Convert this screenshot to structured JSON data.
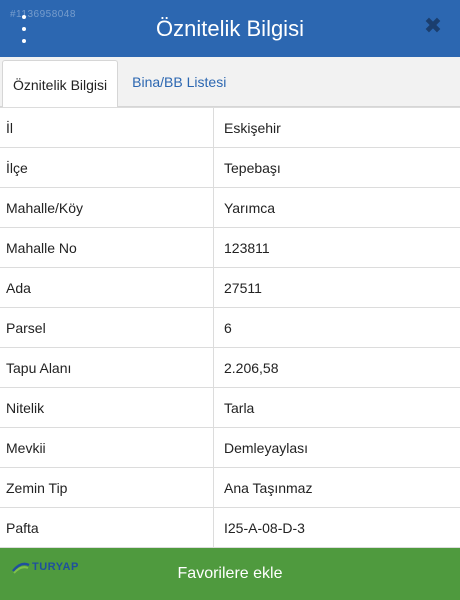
{
  "header": {
    "title": "Öznitelik Bilgisi",
    "listing_id": "#1136958048"
  },
  "tabs": [
    {
      "label": "Öznitelik Bilgisi",
      "active": true
    },
    {
      "label": "Bina/BB Listesi",
      "active": false
    }
  ],
  "attributes": [
    {
      "key": "İl",
      "value": "Eskişehir"
    },
    {
      "key": "İlçe",
      "value": "Tepebaşı"
    },
    {
      "key": "Mahalle/Köy",
      "value": "Yarımca"
    },
    {
      "key": "Mahalle No",
      "value": "123811"
    },
    {
      "key": "Ada",
      "value": "27511"
    },
    {
      "key": "Parsel",
      "value": "6"
    },
    {
      "key": "Tapu Alanı",
      "value": "2.206,58"
    },
    {
      "key": "Nitelik",
      "value": "Tarla"
    },
    {
      "key": "Mevkii",
      "value": "Demleyaylası"
    },
    {
      "key": "Zemin Tip",
      "value": "Ana Taşınmaz"
    },
    {
      "key": "Pafta",
      "value": "I25-A-08-D-3"
    }
  ],
  "footer": {
    "button_label": "Favorilere ekle",
    "logo_text": "TURYAP"
  },
  "colors": {
    "header_bg": "#2c67b1",
    "footer_bg": "#4f9a3e",
    "tab_link": "#2c67b1"
  },
  "icons": {
    "menu": "vertical-dots-icon",
    "close": "close-icon"
  }
}
